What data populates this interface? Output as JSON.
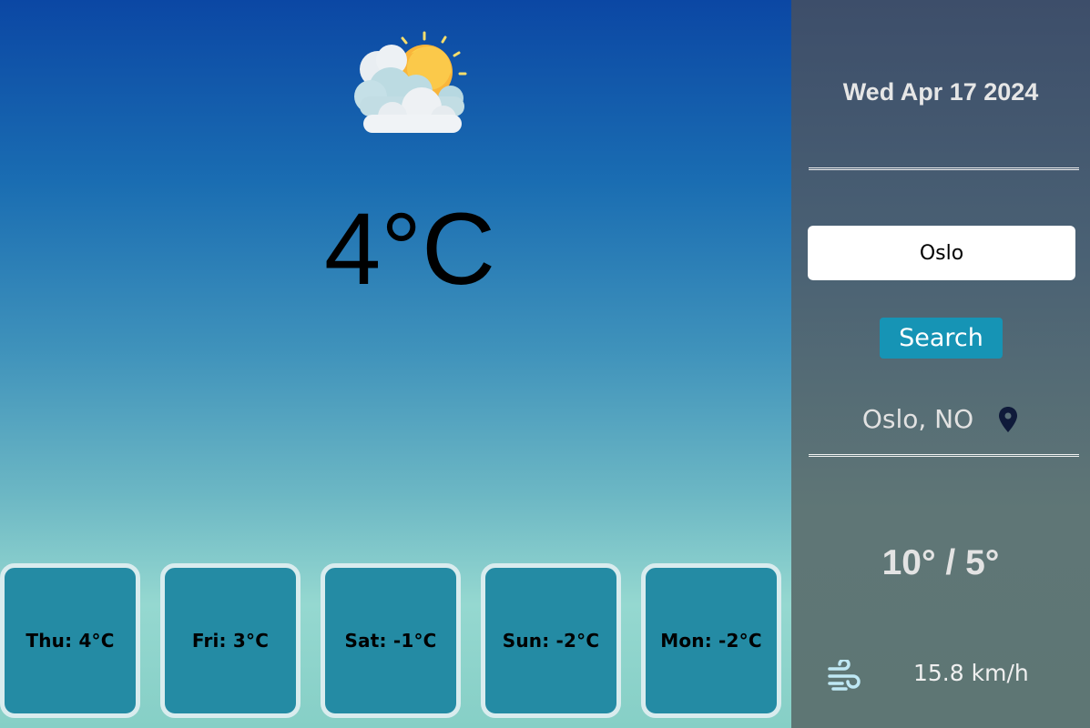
{
  "weather": {
    "icon": "sun-behind-clouds-icon",
    "temperature": "4°C"
  },
  "forecast": [
    {
      "label": "Thu: 4°C"
    },
    {
      "label": "Fri: 3°C"
    },
    {
      "label": "Sat: -1°C"
    },
    {
      "label": "Sun: -2°C"
    },
    {
      "label": "Mon: -2°C"
    }
  ],
  "sidebar": {
    "date": "Wed Apr 17 2024",
    "search": {
      "value": "Oslo",
      "button_label": "Search"
    },
    "location": {
      "text": "Oslo, NO",
      "icon": "location-pin-icon"
    },
    "high_low": "10° / 5°",
    "wind": {
      "icon": "wind-icon",
      "speed": "15.8 km/h"
    }
  },
  "colors": {
    "card_bg": "#248ba4",
    "card_border": "#d9ecee",
    "search_button": "#1694b5",
    "sidebar_top": "#3d4e6a",
    "sidebar_bottom": "#5e7674"
  }
}
